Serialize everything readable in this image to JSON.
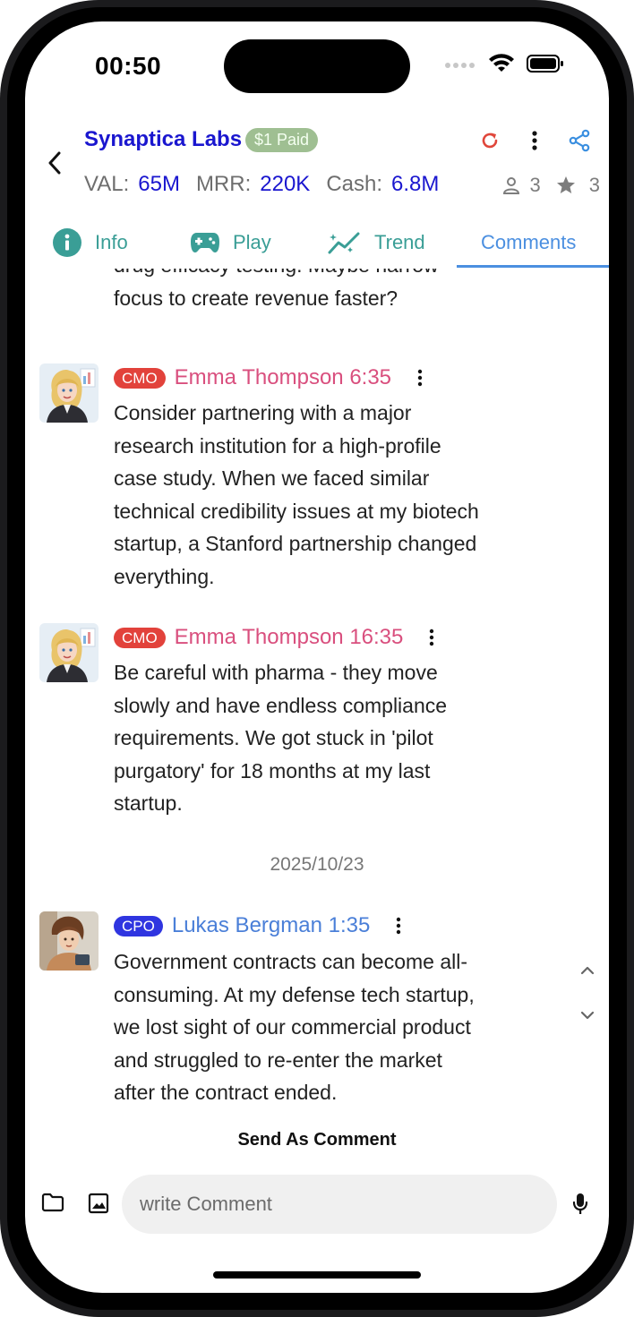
{
  "status_bar": {
    "time": "00:50"
  },
  "header": {
    "company": "Synaptica Labs",
    "badge": "$1 Paid",
    "stats": [
      {
        "label": "VAL:",
        "value": "65M"
      },
      {
        "label": "MRR:",
        "value": "220K"
      },
      {
        "label": "Cash:",
        "value": "6.8M"
      }
    ],
    "members_count": "3",
    "stars_count": "3"
  },
  "tabs": [
    {
      "label": "Info",
      "icon": "info-icon"
    },
    {
      "label": "Play",
      "icon": "gamepad-icon"
    },
    {
      "label": "Trend",
      "icon": "trend-icon"
    },
    {
      "label": "Comments",
      "active": true
    }
  ],
  "comments": {
    "partial_top_line1": "drug efficacy testing. Maybe narrow",
    "partial_top_line2": "focus to create revenue faster?",
    "items": [
      {
        "role": "CMO",
        "author": "Emma Thompson",
        "time": "6:35",
        "lines": [
          "Consider partnering with a major",
          "research institution for a high-profile",
          "case study. When we faced similar",
          "technical credibility issues at my biotech",
          "startup, a Stanford partnership changed",
          "everything."
        ]
      },
      {
        "role": "CMO",
        "author": "Emma Thompson",
        "time": "16:35",
        "lines": [
          "Be careful with pharma - they move",
          "slowly and have endless compliance",
          "requirements. We got stuck in 'pilot",
          "purgatory' for 18 months at my last",
          "startup."
        ]
      },
      {
        "role": "CPO",
        "author": "Lukas Bergman",
        "time": "1:35",
        "lines": [
          "Government contracts can become all-",
          "consuming. At my defense tech startup,",
          "we lost sight of our commercial product",
          "and struggled to re-enter the market",
          "after the contract ended."
        ]
      }
    ],
    "date_separator": "2025/10/23"
  },
  "composer": {
    "send_label": "Send As Comment",
    "placeholder": "write Comment"
  },
  "colors": {
    "brand_blue": "#1a16cf",
    "teal": "#3a9e96",
    "cmo_red": "#e2423b",
    "cmo_name": "#d94f7e",
    "cpo_blue": "#2f35e0",
    "cpo_name": "#4a7fd8",
    "paid_green": "#9fbf92",
    "refresh_red": "#e0463a",
    "share_blue": "#3b8fe0"
  }
}
